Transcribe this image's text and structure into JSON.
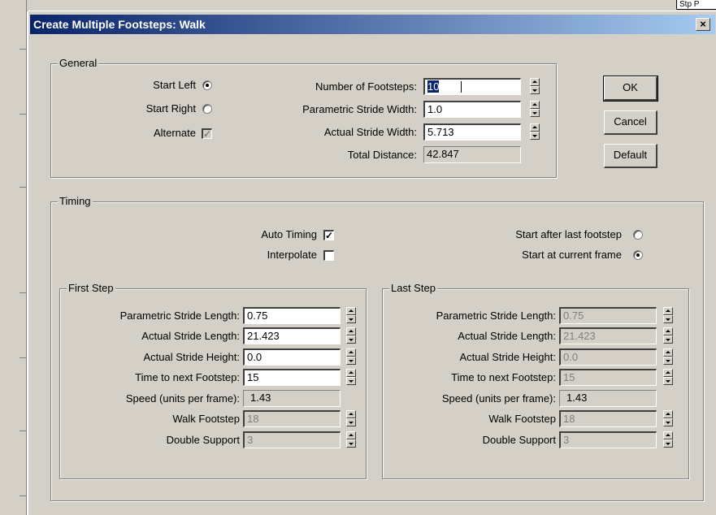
{
  "background_fragment": "Stp P",
  "dialog": {
    "title": "Create Multiple Footsteps: Walk",
    "close_glyph": "×"
  },
  "general": {
    "title": "General",
    "start_left_label": "Start Left",
    "start_right_label": "Start Right",
    "alternate_label": "Alternate",
    "start_left_selected": true,
    "alternate_checked": true,
    "number_of_footsteps_label": "Number of Footsteps:",
    "number_of_footsteps_value": "10",
    "parametric_stride_width_label": "Parametric Stride Width:",
    "parametric_stride_width_value": "1.0",
    "actual_stride_width_label": "Actual Stride Width:",
    "actual_stride_width_value": "5.713",
    "total_distance_label": "Total Distance:",
    "total_distance_value": "42.847"
  },
  "buttons": {
    "ok": "OK",
    "cancel": "Cancel",
    "default": "Default"
  },
  "timing": {
    "title": "Timing",
    "auto_timing_label": "Auto Timing",
    "auto_timing_checked": true,
    "interpolate_label": "Interpolate",
    "interpolate_checked": false,
    "start_after_last_label": "Start after last footstep",
    "start_at_current_label": "Start at current frame",
    "start_at_current_selected": true,
    "check_glyph": "✓"
  },
  "first_step": {
    "title": "First Step",
    "parametric_stride_length_label": "Parametric Stride Length:",
    "parametric_stride_length_value": "0.75",
    "actual_stride_length_label": "Actual Stride Length:",
    "actual_stride_length_value": "21.423",
    "actual_stride_height_label": "Actual Stride Height:",
    "actual_stride_height_value": "0.0",
    "time_to_next_label": "Time to next Footstep:",
    "time_to_next_value": "15",
    "speed_label": "Speed (units per frame):",
    "speed_value": "1.43",
    "walk_footstep_label": "Walk Footstep",
    "walk_footstep_value": "18",
    "double_support_label": "Double Support",
    "double_support_value": "3"
  },
  "last_step": {
    "title": "Last Step",
    "parametric_stride_length_label": "Parametric Stride Length:",
    "parametric_stride_length_value": "0.75",
    "actual_stride_length_label": "Actual Stride Length:",
    "actual_stride_length_value": "21.423",
    "actual_stride_height_label": "Actual Stride Height:",
    "actual_stride_height_value": "0.0",
    "time_to_next_label": "Time to next Footstep:",
    "time_to_next_value": "15",
    "speed_label": "Speed (units per frame):",
    "speed_value": "1.43",
    "walk_footstep_label": "Walk Footstep",
    "walk_footstep_value": "18",
    "double_support_label": "Double Support",
    "double_support_value": "3"
  }
}
